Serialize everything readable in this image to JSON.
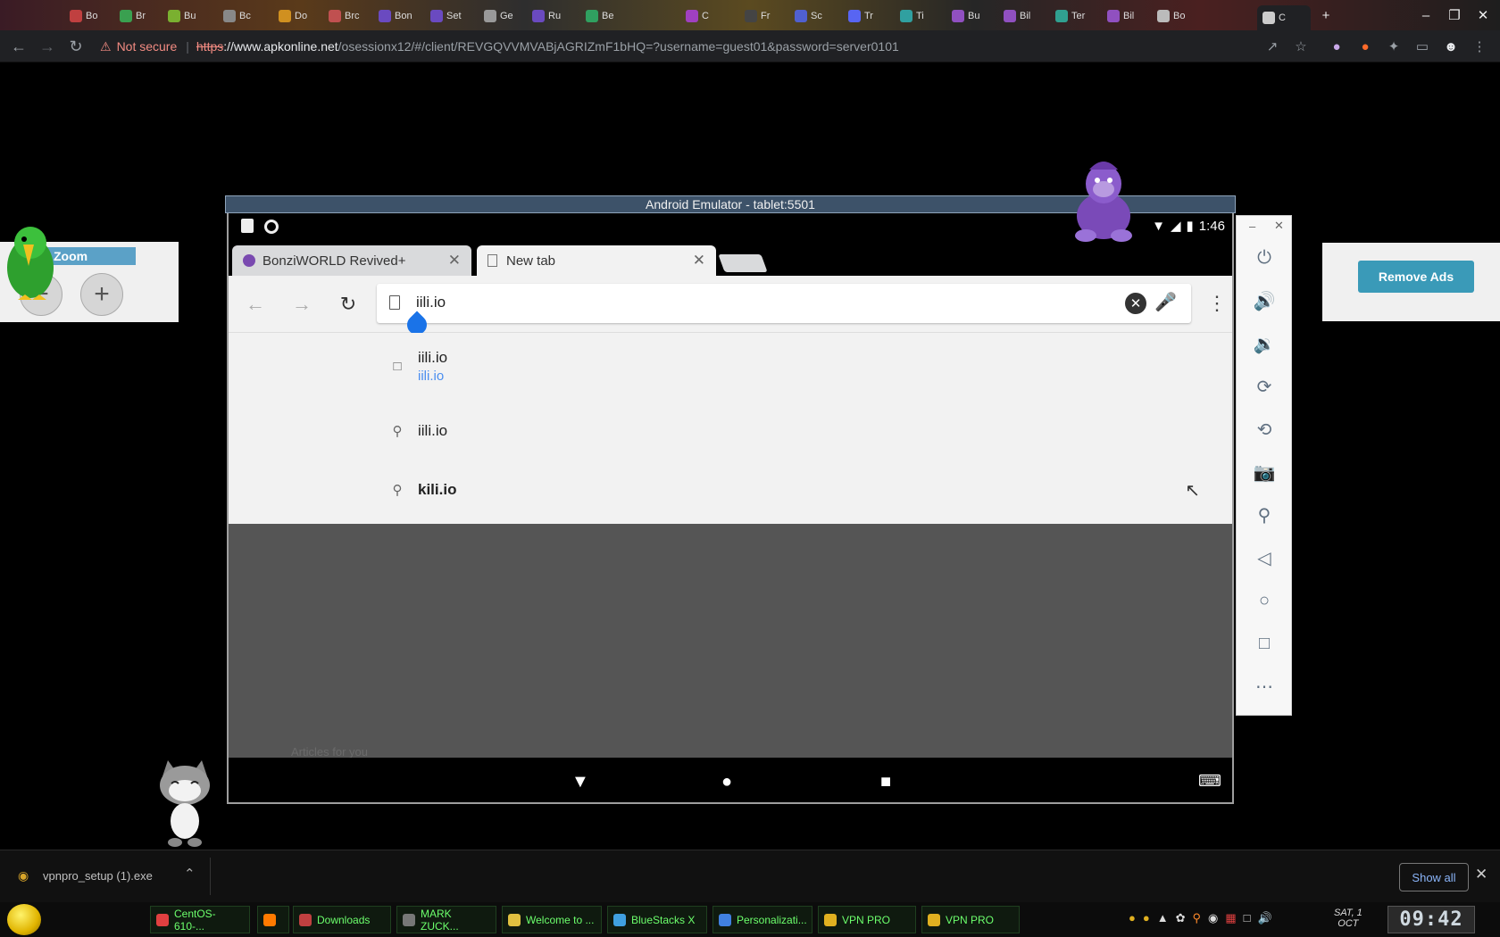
{
  "browser": {
    "tabs": [
      {
        "label": "Bo",
        "color": "#c04040"
      },
      {
        "label": "Br",
        "color": "#3aa050"
      },
      {
        "label": "Bu",
        "color": "#7ab030"
      },
      {
        "label": "Bc",
        "color": "#888888"
      },
      {
        "label": "Do",
        "color": "#d09020"
      },
      {
        "label": "Brc",
        "color": "#c05050"
      },
      {
        "label": "Bon",
        "color": "#6a4ac0"
      },
      {
        "label": "Set",
        "color": "#6a4ac0"
      },
      {
        "label": "Ge",
        "color": "#999999"
      },
      {
        "label": "Ru",
        "color": "#6a4ac0"
      },
      {
        "label": "Be",
        "color": "#30a060"
      },
      {
        "label": "C",
        "color": "#a040c0"
      },
      {
        "label": "Fr",
        "color": "#444444"
      },
      {
        "label": "Sc",
        "color": "#5060d0"
      },
      {
        "label": "Tr",
        "color": "#5865f2"
      },
      {
        "label": "Ti",
        "color": "#30a0a0"
      },
      {
        "label": "Bu",
        "color": "#9050c0"
      },
      {
        "label": "Bil",
        "color": "#9050c0"
      },
      {
        "label": "Ter",
        "color": "#30a090"
      },
      {
        "label": "Bil",
        "color": "#9050c0"
      },
      {
        "label": "Bo",
        "color": "#bbbbbb"
      },
      {
        "label": "C",
        "color": "#cccccc"
      }
    ],
    "window_controls": {
      "minimize": "–",
      "maximize": "❐",
      "close": "✕"
    },
    "new_tab_label": "+",
    "security_label": "Not secure",
    "url_scheme": "https",
    "url_host": "://www.apkonline.net",
    "url_path": "/osessionx12/#/client/REVGQVVMVABjAGRIZmF1bHQ=?username=guest01&password=server0101"
  },
  "emulator": {
    "title": "Android Emulator - tablet:5501",
    "status_time": "1:46",
    "chrome_tabs": [
      {
        "label": "BonziWORLD Revived+"
      },
      {
        "label": "New tab"
      }
    ],
    "address_value": "iili.io",
    "suggestions": [
      {
        "text": "iili.io",
        "sub": "iili.io",
        "icon": "page-icon"
      },
      {
        "text": "iili.io",
        "icon": "search-icon"
      },
      {
        "text": "kili.io",
        "icon": "search-icon"
      }
    ],
    "articles_label": "Articles for you"
  },
  "side_panel": {
    "icons": [
      "power-icon",
      "volume-up-icon",
      "volume-down-icon",
      "rotate-left-icon",
      "rotate-right-icon",
      "camera-icon",
      "zoom-icon",
      "back-icon",
      "home-icon",
      "overview-icon",
      "more-icon"
    ]
  },
  "zoom_widget": {
    "label": "Zoom",
    "minus": "−",
    "plus": "+"
  },
  "ads": {
    "remove_label": "Remove Ads"
  },
  "download": {
    "filename": "vpnpro_setup (1).exe",
    "show_all": "Show all"
  },
  "taskbar": {
    "items": [
      {
        "label": "CentOS-610-...",
        "color": "#e04040"
      },
      {
        "label": "",
        "color": "#ff7a00"
      },
      {
        "label": "Downloads",
        "color": "#c04040"
      },
      {
        "label": "MARK ZUCK...",
        "color": "#777777"
      },
      {
        "label": "Welcome to ...",
        "color": "#e0c040"
      },
      {
        "label": "BlueStacks X",
        "color": "#40a0e0"
      },
      {
        "label": "Personalizati...",
        "color": "#4080e0"
      },
      {
        "label": "VPN PRO",
        "color": "#e0b020"
      },
      {
        "label": "VPN PRO",
        "color": "#e0b020"
      }
    ],
    "date_line1": "SAT, 1",
    "date_line2": "OCT",
    "clock": "09:42"
  }
}
